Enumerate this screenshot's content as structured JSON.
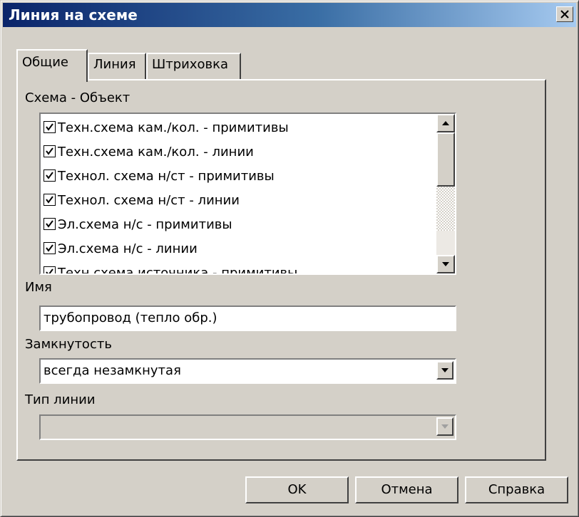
{
  "window": {
    "title": "Линия на схеме",
    "close_icon": "close-icon"
  },
  "tabs": [
    {
      "label": "Общие",
      "active": true
    },
    {
      "label": "Линия",
      "active": false
    },
    {
      "label": "Штриховка",
      "active": false
    }
  ],
  "scheme_object": {
    "label": "Схема  - Объект",
    "items": [
      {
        "label": "Техн.схема кам./кол.  - примитивы",
        "checked": true
      },
      {
        "label": "Техн.схема кам./кол.  - линии",
        "checked": true
      },
      {
        "label": "Технол. схема н/ст  - примитивы",
        "checked": true
      },
      {
        "label": "Технол. схема н/ст  - линии",
        "checked": true
      },
      {
        "label": "Эл.схема н/с  - примитивы",
        "checked": true
      },
      {
        "label": "Эл.схема н/с  - линии",
        "checked": true
      },
      {
        "label": "Техн.схема источника  - примитивы",
        "checked": true
      }
    ]
  },
  "name_field": {
    "label": "Имя",
    "value": "трубопровод (тепло обр.)"
  },
  "closure": {
    "label": "Замкнутость",
    "value": "всегда незамкнутая"
  },
  "line_type": {
    "label": "Тип линии",
    "value": "",
    "disabled": true
  },
  "buttons": {
    "ok": "OK",
    "cancel": "Отмена",
    "help": "Справка"
  }
}
